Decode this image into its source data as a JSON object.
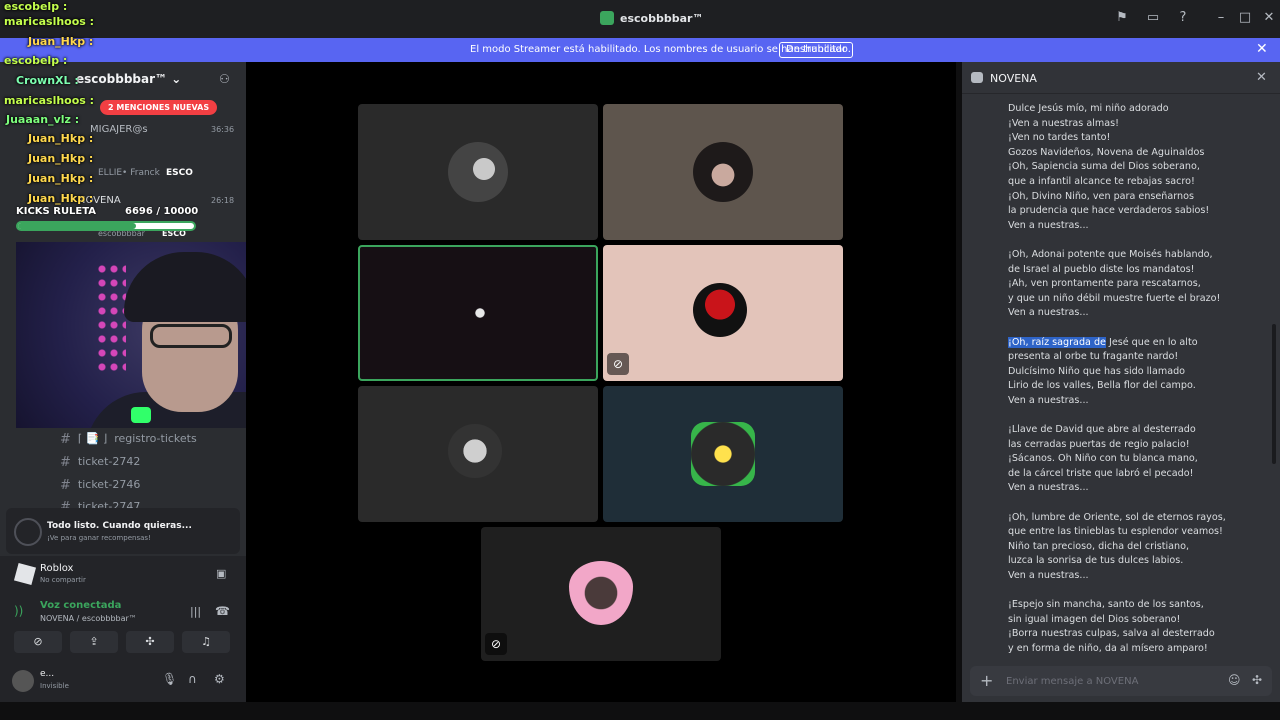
{
  "window": {
    "title": "escobbbbar™",
    "streamer_message": "El modo Streamer está habilitado. Los nombres de usuario se han truncado.",
    "disable_button": "Deshabilitar"
  },
  "sidebar": {
    "server_name": "escobbbbar™",
    "mentions_pill": "2 MENCIONES NUEVAS",
    "voice_users": [
      {
        "name": "MIGAJER@s",
        "time": "36:36"
      },
      {
        "name": "ELLIE• Franck",
        "tag": "ESCO"
      },
      {
        "name": "NOVENA",
        "time": "26:18"
      },
      {
        "name": "escobbbbar",
        "tag": "ESCO"
      }
    ],
    "channels": [
      {
        "name": "registro-tickets",
        "prefix": "⌈ 📑 ⌋"
      },
      {
        "name": "ticket-2742"
      },
      {
        "name": "ticket-2746"
      },
      {
        "name": "ticket-2747"
      }
    ],
    "activity": {
      "title": "Todo listo. Cuando quieras...",
      "subtitle": "¡Ve para ganar recompensas!"
    },
    "game": {
      "name": "Roblox",
      "status": "No compartir"
    },
    "voice": {
      "status": "Voz conectada",
      "location": "NOVENA / escobbbbar™"
    },
    "user": {
      "name": "e...",
      "status": "Invisible"
    }
  },
  "overlay": {
    "kicks_label": "KICKS RULETA",
    "kicks_progress": "6696 / 10000",
    "kicks_fraction": 0.67,
    "chat_lines": [
      {
        "user": "escobelp :",
        "color": "#c4ff4d"
      },
      {
        "user": "maricaslhoos :",
        "color": "#c4ff4d"
      },
      {
        "user": "Juan_Hkp :",
        "color": "#ffd84d"
      },
      {
        "user": "escobelp :",
        "color": "#c4ff4d"
      },
      {
        "user": "CrownXL :",
        "color": "#7dffb0"
      },
      {
        "user": "maricaslhoos :",
        "color": "#c4ff4d"
      },
      {
        "user": "Juaaan_vlz :",
        "color": "#7dff7d"
      },
      {
        "user": "Juan_Hkp :",
        "color": "#ffd84d"
      },
      {
        "user": "Juan_Hkp :",
        "color": "#ffd84d"
      },
      {
        "user": "Juan_Hkp :",
        "color": "#ffd84d"
      },
      {
        "user": "Juan_Hkp :",
        "color": "#ffd84d"
      }
    ]
  },
  "chat": {
    "title": "NOVENA",
    "placeholder": "Enviar mensaje a NOVENA",
    "paragraphs": [
      [
        "Dulce Jesús mío, mi niño adorado",
        "¡Ven a nuestras almas!",
        "¡Ven no tardes tanto!",
        "Gozos Navideños, Novena de Aguinaldos",
        "¡Oh, Sapiencia suma del Dios soberano,",
        "que a infantil alcance te rebajas sacro!",
        "¡Oh, Divino Niño, ven para enseñarnos",
        "la prudencia que hace verdaderos sabios!",
        "Ven a nuestras..."
      ],
      [
        "¡Oh, Adonai potente que Moisés hablando,",
        "de Israel al pueblo diste los mandatos!",
        "¡Ah, ven prontamente para rescatarnos,",
        "y que un niño débil muestre fuerte el brazo!",
        "Ven a nuestras..."
      ],
      [
        "¡Oh, raíz sagrada de Jesé que en lo alto",
        "presenta al orbe tu fragante nardo!",
        "Dulcísimo Niño que has sido llamado",
        "Lirio de los valles, Bella flor del campo.",
        "Ven a nuestras..."
      ],
      [
        "¡Llave de David que abre al desterrado",
        "las cerradas puertas de regio palacio!",
        "¡Sácanos. Oh Niño con tu blanca mano,",
        "de la cárcel triste que labró el pecado!",
        "Ven a nuestras..."
      ],
      [
        "¡Oh, lumbre de Oriente, sol de eternos rayos,",
        "que entre las tinieblas tu esplendor veamos!",
        "Niño tan precioso, dicha del cristiano,",
        "luzca la sonrisa de tus dulces labios.",
        "Ven a nuestras..."
      ],
      [
        "¡Espejo sin mancha, santo de los santos,",
        "sin igual imagen del Dios soberano!",
        "¡Borra nuestras culpas, salva al desterrado",
        "y en forma de niño, da al mísero amparo!"
      ]
    ],
    "highlight": "¡Oh, raíz sagrada de"
  },
  "colors": {
    "accent": "#5865f2",
    "voice_green": "#3ba55d",
    "mention_red": "#f23f43"
  }
}
